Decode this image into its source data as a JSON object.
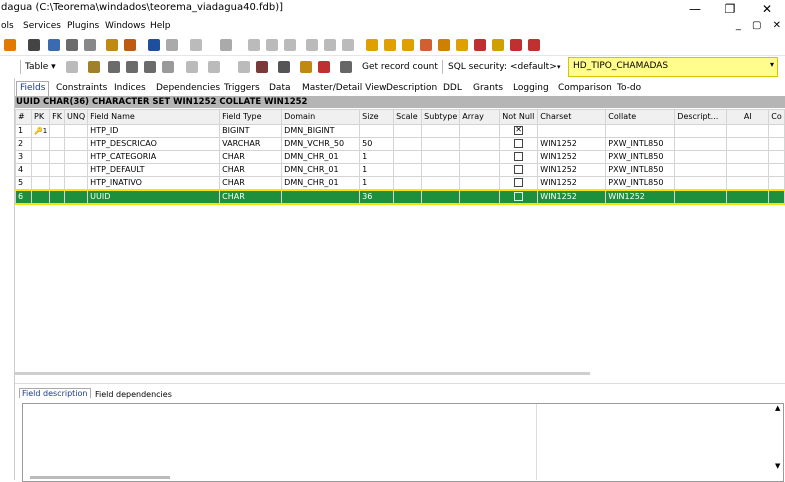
{
  "window": {
    "title": "dagua (C:\\Teorema\\windados\\teorema_viadagua40.fdb)]",
    "minimize": "—",
    "maximize": "❐",
    "close": "✕"
  },
  "menu": {
    "items": [
      "ols",
      "Services",
      "Plugins",
      "Windows",
      "Help"
    ],
    "mdi_controls": "_ ▢ ✕"
  },
  "toolbar2": {
    "table_label": "Table ▾",
    "get_record_count": "Get record count",
    "sql_security_label": "SQL security:",
    "sql_security_value": "<default>",
    "table_selector": "HD_TIPO_CHAMADAS"
  },
  "tabs": [
    "Fields",
    "Constraints",
    "Indices",
    "Dependencies",
    "Triggers",
    "Data",
    "Master/Detail View",
    "Description",
    "DDL",
    "Grants",
    "Logging",
    "Comparison",
    "To-do"
  ],
  "infobar": "UUID CHAR(36) CHARACTER SET WIN1252 COLLATE WIN1252",
  "grid": {
    "headers": [
      "#",
      "PK",
      "FK",
      "UNQ",
      "Field Name",
      "Field Type",
      "Domain",
      "Size",
      "Scale",
      "Subtype",
      "Array",
      "Not Null",
      "Charset",
      "Collate",
      "Descript...",
      "AI",
      "Co"
    ],
    "rows": [
      {
        "n": "1",
        "pk": "🔑1",
        "name": "HTP_ID",
        "type": "BIGINT",
        "domain": "DMN_BIGINT",
        "size": "",
        "notnull": true,
        "charset": "",
        "collate": ""
      },
      {
        "n": "2",
        "pk": "",
        "name": "HTP_DESCRICAO",
        "type": "VARCHAR",
        "domain": "DMN_VCHR_50",
        "size": "50",
        "notnull": false,
        "charset": "WIN1252",
        "collate": "PXW_INTL850"
      },
      {
        "n": "3",
        "pk": "",
        "name": "HTP_CATEGORIA",
        "type": "CHAR",
        "domain": "DMN_CHR_01",
        "size": "1",
        "notnull": false,
        "charset": "WIN1252",
        "collate": "PXW_INTL850"
      },
      {
        "n": "4",
        "pk": "",
        "name": "HTP_DEFAULT",
        "type": "CHAR",
        "domain": "DMN_CHR_01",
        "size": "1",
        "notnull": false,
        "charset": "WIN1252",
        "collate": "PXW_INTL850"
      },
      {
        "n": "5",
        "pk": "",
        "name": "HTP_INATIVO",
        "type": "CHAR",
        "domain": "DMN_CHR_01",
        "size": "1",
        "notnull": false,
        "charset": "WIN1252",
        "collate": "PXW_INTL850"
      },
      {
        "n": "6",
        "pk": "",
        "name": "UUID",
        "type": "CHAR",
        "domain": "",
        "size": "36",
        "notnull": false,
        "charset": "WIN1252",
        "collate": "WIN1252"
      }
    ]
  },
  "lower_tabs": [
    "Field description",
    "Field dependencies"
  ],
  "colors": {
    "selected_row": "#1d8f3d",
    "selected_border": "#f5e600",
    "combo_bg": "#fffd8c",
    "infobar_bg": "#b5b5b5"
  }
}
